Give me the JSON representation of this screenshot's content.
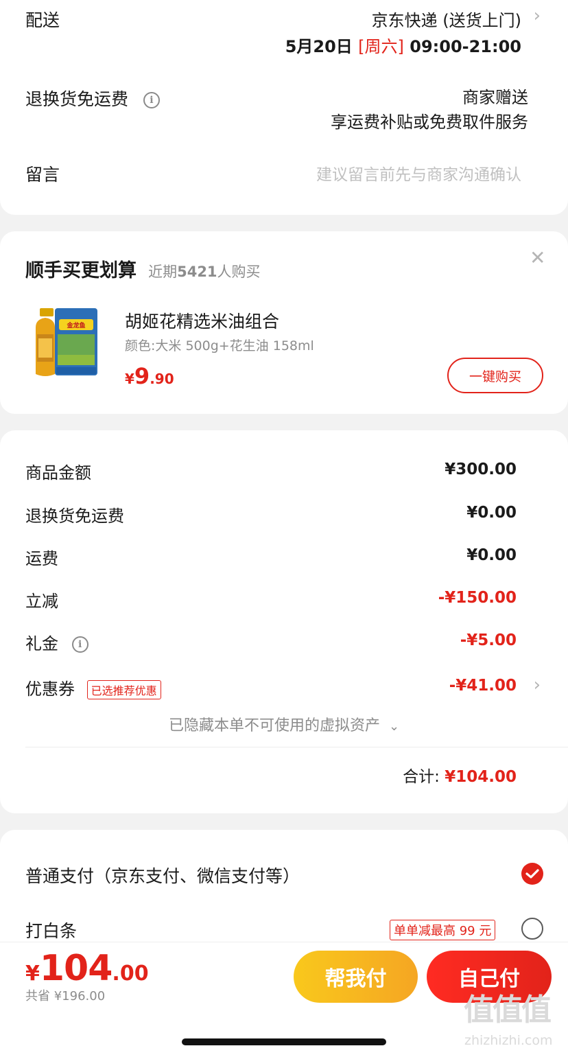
{
  "shipping": {
    "label": "配送",
    "method": "京东快递 (送货上门)",
    "date": "5月20日",
    "weekday": "[周六]",
    "time": "09:00-21:00",
    "return_label": "退换货免运费",
    "return_value_1": "商家赠送",
    "return_value_2": "享运费补贴或免费取件服务",
    "note_label": "留言",
    "note_placeholder": "建议留言前先与商家沟通确认"
  },
  "upsell": {
    "title": "顺手买更划算",
    "subtitle_prefix": "近期",
    "subtitle_count": "5421",
    "subtitle_suffix": "人购买",
    "product_name": "胡姬花精选米油组合",
    "product_spec": "颜色:大米 500g+花生油 158ml",
    "price_symbol": "¥",
    "price_int": "9",
    "price_dec": ".90",
    "buy_button": "一键购买",
    "image_label": "金龙鱼"
  },
  "price_detail": {
    "rows": [
      {
        "label": "商品金额",
        "value": "¥300.00"
      },
      {
        "label": "退换货免运费",
        "value": "¥0.00"
      },
      {
        "label": "运费",
        "value": "¥0.00"
      },
      {
        "label": "立减",
        "value": "-¥150.00"
      },
      {
        "label": "礼金",
        "value": "-¥5.00"
      },
      {
        "label": "优惠券",
        "value": "-¥41.00"
      }
    ],
    "coupon_tag": "已选推荐优惠",
    "hidden_assets": "已隐藏本单不可使用的虚拟资产",
    "total_label": "合计:",
    "total_value": "¥104.00"
  },
  "payment": {
    "normal_label": "普通支付（京东支付、微信支付等）",
    "baitiao_label": "打白条",
    "baitiao_tag": "单单减最高 99 元"
  },
  "bottom_bar": {
    "price_symbol": "¥",
    "price_int": "104",
    "price_dec": ".00",
    "saved": "共省 ¥196.00",
    "help_pay": "帮我付",
    "self_pay": "自己付"
  },
  "watermark": {
    "logo": "值值值",
    "site": "zhizhizhi.com"
  },
  "colors": {
    "accent": "#e2231a",
    "help_button": "#f5a623",
    "background": "#f2f2f2"
  }
}
